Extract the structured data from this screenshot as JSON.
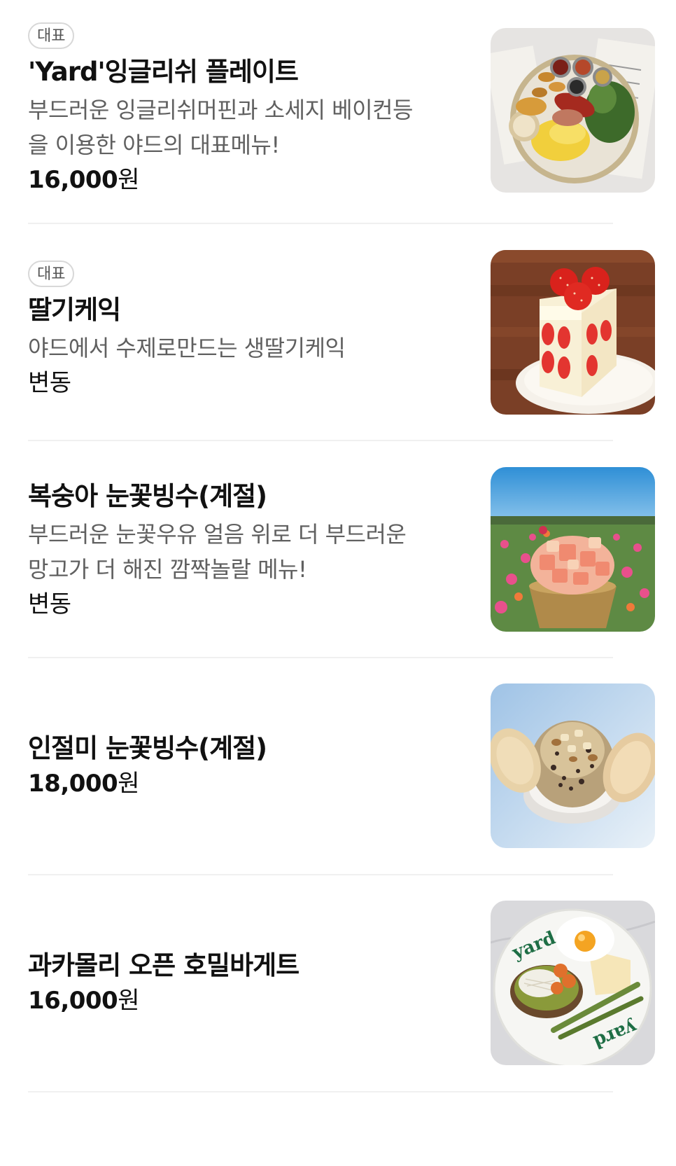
{
  "menu": {
    "items": [
      {
        "badge": "대표",
        "title": "'Yard'잉글리쉬 플레이트",
        "desc_lines": [
          "부드러운 잉글리쉬머핀과 소세지 베이컨등",
          "을 이용한 야드의 대표메뉴!"
        ],
        "price_number": "16,000",
        "price_unit": "원",
        "image": "english-plate-photo"
      },
      {
        "badge": "대표",
        "title": "딸기케익",
        "desc_lines": [
          "야드에서 수제로만드는 생딸기케익"
        ],
        "price_text": "변동",
        "image": "strawberry-cake-photo"
      },
      {
        "title": "복숭아 눈꽃빙수(계절)",
        "desc_lines": [
          "부드러운 눈꽃우유 얼음 위로 더 부드러운",
          "망고가 더 해진 깜짝놀랄 메뉴!"
        ],
        "price_text": "변동",
        "image": "peach-bingsu-photo"
      },
      {
        "title": "인절미 눈꽃빙수(계절)",
        "price_number": "18,000",
        "price_unit": "원",
        "image": "injeolmi-bingsu-photo"
      },
      {
        "title": "과카몰리 오픈 호밀바게트",
        "price_number": "16,000",
        "price_unit": "원",
        "image": "guacamole-baguette-photo",
        "plate_text": "yard"
      }
    ]
  }
}
